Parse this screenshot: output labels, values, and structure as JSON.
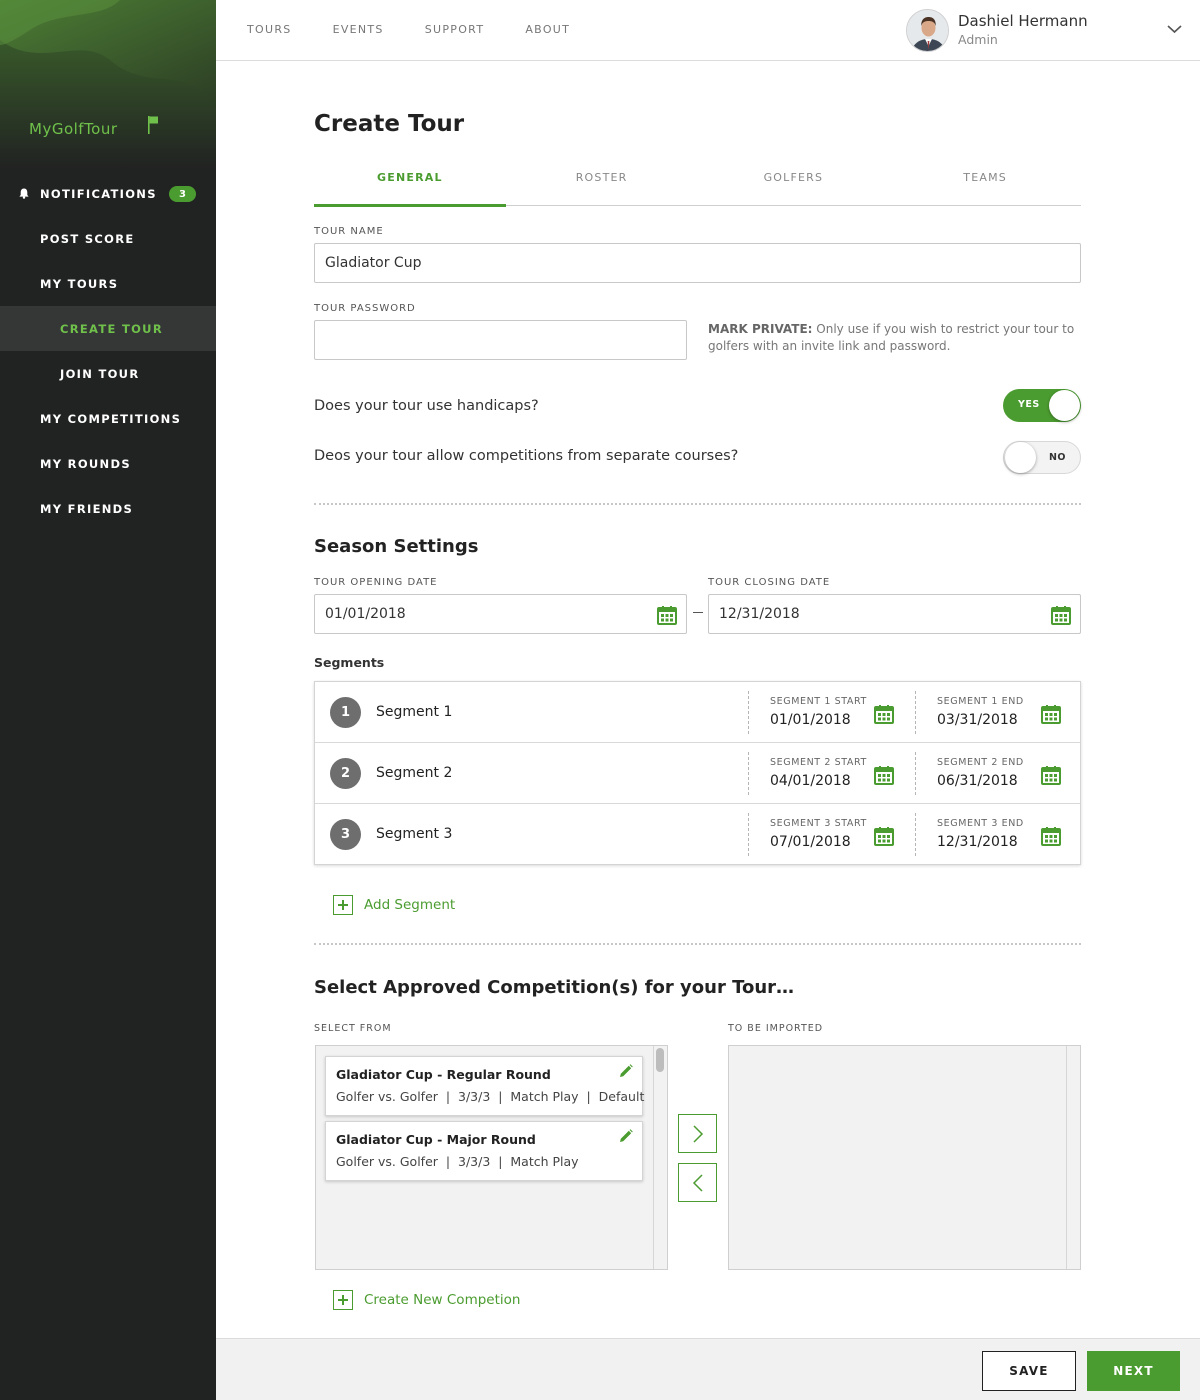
{
  "app": {
    "logo": "MyGolfTour"
  },
  "sidebar": {
    "notifications_label": "NOTIFICATIONS",
    "notifications_count": "3",
    "items": [
      {
        "label": "POST SCORE"
      },
      {
        "label": "MY TOURS"
      },
      {
        "label": "CREATE TOUR"
      },
      {
        "label": "JOIN TOUR"
      },
      {
        "label": "MY COMPETITIONS"
      },
      {
        "label": "MY ROUNDS"
      },
      {
        "label": "MY FRIENDS"
      }
    ]
  },
  "topnav": {
    "items": [
      "TOURS",
      "EVENTS",
      "SUPPORT",
      "ABOUT"
    ]
  },
  "user": {
    "name": "Dashiel Hermann",
    "role": "Admin"
  },
  "page": {
    "title": "Create Tour",
    "tabs": [
      "GENERAL",
      "ROSTER",
      "GOLFERS",
      "TEAMS"
    ],
    "active_tab": "GENERAL"
  },
  "general": {
    "tour_name_label": "TOUR NAME",
    "tour_name_value": "Gladiator Cup",
    "tour_password_label": "TOUR PASSWORD",
    "tour_password_value": "",
    "mark_private_label": "MARK PRIVATE:",
    "mark_private_text": "Only use if you wish to restrict your tour to golfers with an invite link and password.",
    "handicaps_question": "Does your tour use handicaps?",
    "handicaps_toggle": "YES",
    "courses_question": "Deos your tour allow competitions from separate courses?",
    "courses_toggle": "NO"
  },
  "season": {
    "title": "Season Settings",
    "opening_label": "TOUR OPENING DATE",
    "opening_value": "01/01/2018",
    "closing_label": "TOUR CLOSING DATE",
    "closing_value": "12/31/2018",
    "segments_title": "Segments",
    "segments": [
      {
        "num": "1",
        "name": "Segment 1",
        "start_label": "SEGMENT 1 START",
        "start": "01/01/2018",
        "end_label": "SEGMENT 1 END",
        "end": "03/31/2018"
      },
      {
        "num": "2",
        "name": "Segment 2",
        "start_label": "SEGMENT 2 START",
        "start": "04/01/2018",
        "end_label": "SEGMENT 2 END",
        "end": "06/31/2018"
      },
      {
        "num": "3",
        "name": "Segment 3",
        "start_label": "SEGMENT 3 START",
        "start": "07/01/2018",
        "end_label": "SEGMENT 3 END",
        "end": "12/31/2018"
      }
    ],
    "add_segment": "Add Segment"
  },
  "competitions": {
    "title": "Select Approved Competition(s) for your Tour…",
    "select_from_label": "SELECT FROM",
    "to_be_imported_label": "TO BE IMPORTED",
    "available": [
      {
        "title": "Gladiator Cup - Regular Round",
        "meta": "Golfer vs. Golfer  |  3/3/3  |  Match Play  |  Default"
      },
      {
        "title": "Gladiator Cup - Major Round",
        "meta": "Golfer vs. Golfer  |  3/3/3  |  Match Play"
      }
    ],
    "create_new": "Create New Competion"
  },
  "footer": {
    "save": "SAVE",
    "next": "NEXT"
  },
  "colors": {
    "accent": "#4b9c30",
    "sidebar": "#212222",
    "logo": "#6fc14b"
  },
  "icons": [
    "bell-icon",
    "flag-icon",
    "chevron-down-icon",
    "calendar-icon",
    "pencil-icon",
    "plus-icon",
    "chevron-right-icon",
    "chevron-left-icon"
  ]
}
